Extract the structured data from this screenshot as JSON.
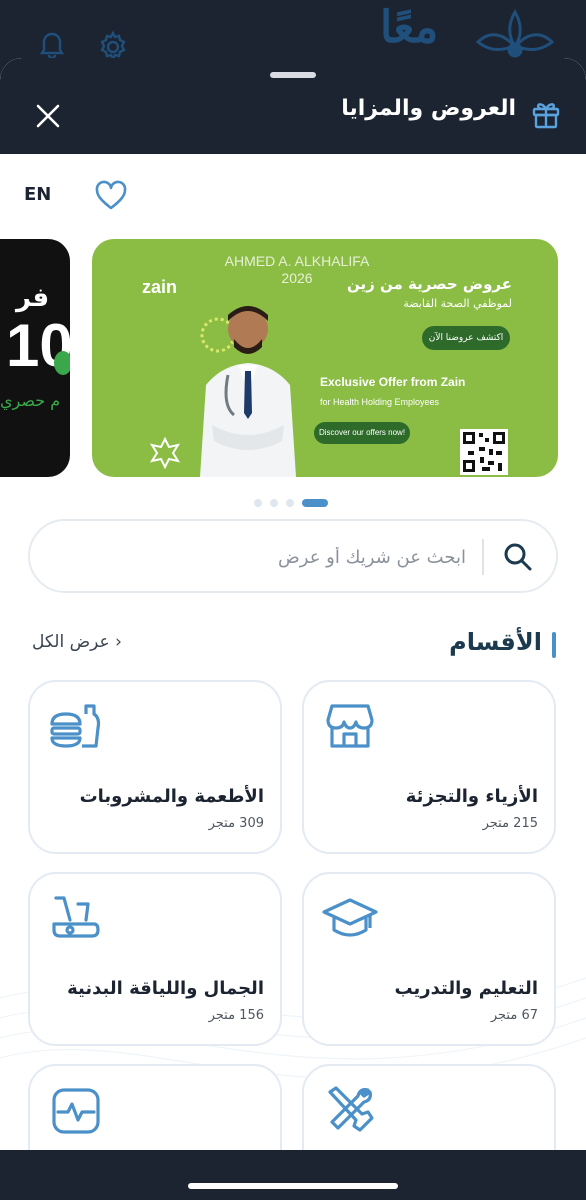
{
  "header": {
    "title": "العروض والمزايا",
    "logo_text": "معًا"
  },
  "language_toggle": "EN",
  "banner": {
    "watermark_name": "AHMED A. ALKHALIFA",
    "watermark_year": "2026",
    "brand": "zain",
    "title_ar": "عروض حصرية من زين",
    "subtitle_ar": "لموظفي الصحة القابضة",
    "cta_ar": "اكتشف عروضنا الآن",
    "title_en": "Exclusive Offer from Zain",
    "subtitle_en": "for Health  Holding Employees",
    "cta_en": "Discover our offers now!",
    "colors": {
      "background": "#8bbd45",
      "button": "#2e6b2a"
    }
  },
  "prev_card": {
    "big_text": "10",
    "top_text": "فر",
    "bottom_text": "م حصري"
  },
  "carousel": {
    "page_count": 4,
    "active_index": 3
  },
  "search": {
    "placeholder": "ابحث عن شريك أو عرض"
  },
  "categories_section": {
    "title": "الأقسام",
    "see_all": "عرض الكل"
  },
  "categories": [
    {
      "name": "الأزياء والتجزئة",
      "count": "215 متجر",
      "icon": "storefront-icon"
    },
    {
      "name": "الأطعمة والمشروبات",
      "count": "309 متجر",
      "icon": "food-drink-icon"
    },
    {
      "name": "التعليم والتدريب",
      "count": "67 متجر",
      "icon": "graduation-cap-icon"
    },
    {
      "name": "الجمال واللياقة البدنية",
      "count": "156 متجر",
      "icon": "exercise-bike-icon"
    },
    {
      "name": "",
      "count": "",
      "icon": "tools-icon"
    },
    {
      "name": "",
      "count": "",
      "icon": "health-monitor-icon"
    }
  ],
  "colors": {
    "accent": "#4b90c8",
    "dark": "#1c2431"
  }
}
